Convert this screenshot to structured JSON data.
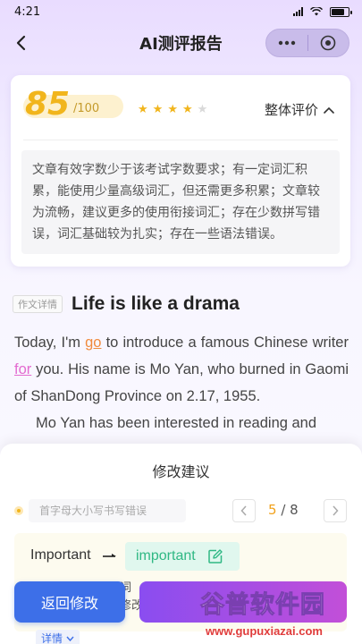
{
  "status_bar": {
    "time": "4:21"
  },
  "nav": {
    "title": "AI测评报告"
  },
  "score": {
    "value": "85",
    "total": "/100",
    "stars_full": 4,
    "stars_total": 5,
    "overall_label": "整体评价",
    "evaluation": "文章有效字数少于该考试字数要求；有一定词汇积累，能使用少量高级词汇，但还需更多积累；文章较为流畅，建议更多的使用衔接词汇；存在少数拼写错误，词汇基础较为扎实；存在一些语法错误。"
  },
  "essay": {
    "tag": "作文详情",
    "title": "Life is like a drama",
    "p1_a": "Today, I'm ",
    "p1_hl1": "go",
    "p1_b": " to introduce a famous Chinese writer ",
    "p1_hl2": "for",
    "p1_c": " you. His name is Mo Yan, who burned in Gaomi of ShanDong Province on 2.17, 1955.",
    "p2": "Mo Yan has been interested in reading and"
  },
  "sheet": {
    "title": "修改建议",
    "suggestion_type": "首字母大小写书写错误",
    "page_current": "5",
    "page_total": "/ 8",
    "wrong_word": "Important",
    "correct_word": "important",
    "note_line1": "词",
    "note_line2": "修改",
    "back_button": "返回修改",
    "details_label": "详情"
  },
  "watermark": {
    "main": "谷普软件园",
    "url": "www.gupuxiazai.com"
  },
  "colors": {
    "accent_gold": "#f1b51c",
    "accent_blue": "#3d6fe8",
    "accent_purple": "#8a4df0",
    "correct_green": "#2fb884"
  },
  "icons": {
    "back": "chevron-left-icon",
    "more": "more-dots-icon",
    "close": "target-circle-icon",
    "overall_toggle": "chevron-up-icon",
    "edit": "edit-icon"
  }
}
